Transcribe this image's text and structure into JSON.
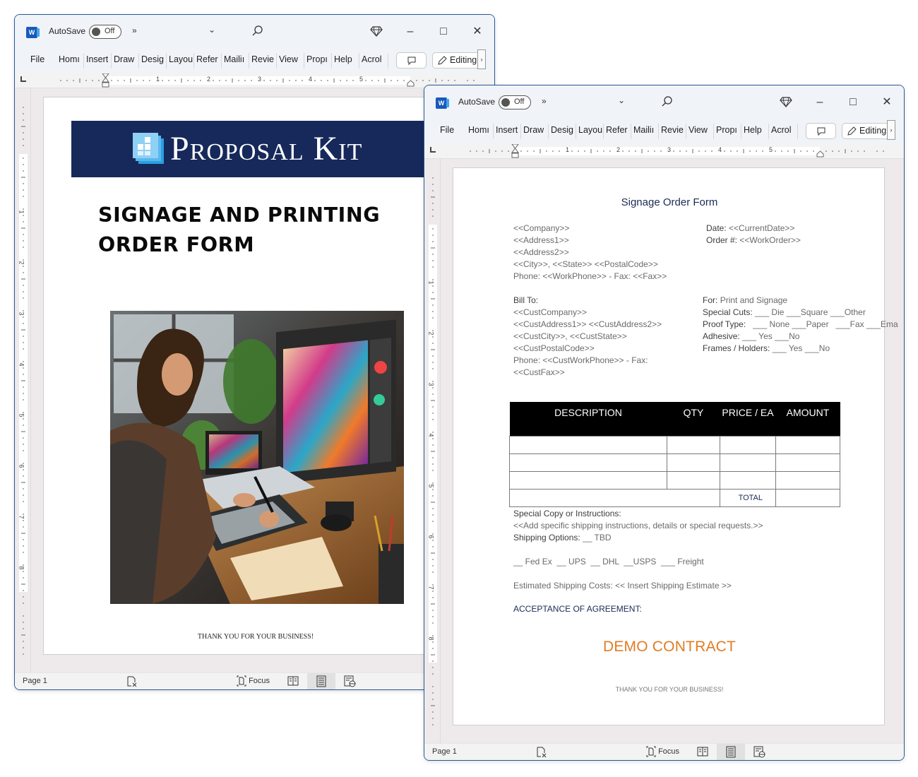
{
  "windows": [
    {
      "id": "win1",
      "app_icon": "word-icon",
      "autosave_label": "AutoSave",
      "autosave_state": "Off",
      "more_commands": "»",
      "ribbon_tabs": [
        "File",
        "Home",
        "Insert",
        "Draw",
        "Design",
        "Layout",
        "References",
        "Mailings",
        "Review",
        "View",
        "Properties",
        "Help",
        "Acrobat"
      ],
      "ribbon_tabs_visible": [
        "File",
        "Homı",
        "Insert",
        "Draw",
        "Desig",
        "Layou",
        "Refer",
        "Mailiı",
        "Revie",
        "View",
        "Propı",
        "Help",
        "Acrol"
      ],
      "editing_label": "Editing",
      "ruler_numbers": [
        "1",
        "2",
        "3",
        "4",
        "5"
      ],
      "vruler_numbers": [
        "1",
        "2",
        "3",
        "4",
        "5",
        "6",
        "7",
        "8"
      ],
      "status": {
        "page": "Page 1",
        "focus_label": "Focus"
      },
      "document": {
        "brand_name": "Proposal Kit",
        "brand_colors": {
          "banner": "#16295a",
          "logo_light": "#8fd0f5",
          "logo_accent": "#2a9fe0"
        },
        "title_line1": "SIGNAGE AND PRINTING",
        "title_line2": "ORDER FORM",
        "image_description": "Woman drawing on a pen tablet at a desk in front of a monitor showing colorful digital artwork",
        "footer": "THANK YOU FOR YOUR BUSINESS!"
      }
    },
    {
      "id": "win2",
      "app_icon": "word-icon",
      "autosave_label": "AutoSave",
      "autosave_state": "Off",
      "more_commands": "»",
      "ribbon_tabs_visible": [
        "File",
        "Homı",
        "Insert",
        "Draw",
        "Desig",
        "Layou",
        "Refer",
        "Mailiı",
        "Revie",
        "View",
        "Propı",
        "Help",
        "Acrol"
      ],
      "editing_label": "Editing",
      "ruler_numbers": [
        "1",
        "2",
        "3",
        "4",
        "5"
      ],
      "vruler_numbers": [
        "1",
        "2",
        "3",
        "4",
        "5",
        "6",
        "7",
        "8"
      ],
      "status": {
        "page": "Page 1",
        "focus_label": "Focus"
      },
      "document": {
        "title": "Signage Order Form",
        "company_lines": [
          "<<Company>>",
          "<<Address1>>",
          "<<Address2>>",
          "<<City>>, <<State>>  <<PostalCode>>",
          "Phone: <<WorkPhone>>  - Fax: <<Fax>>"
        ],
        "date_label": "Date:",
        "date_value": "<<CurrentDate>>",
        "order_label": "Order #:",
        "order_value": "<<WorkOrder>>",
        "bill_to_label": "Bill To:",
        "bill_to_lines": [
          "<<CustCompany>>",
          "<<CustAddress1>> <<CustAddress2>>",
          "<<CustCity>>, <<CustState>>",
          "<<CustPostalCode>>",
          "Phone: <<CustWorkPhone>>  - Fax:",
          "<<CustFax>>"
        ],
        "for_label": "For:",
        "for_value": "Print and Signage",
        "special_cuts_label": "Special Cuts:",
        "special_cuts_value": "___ Die  ___Square  ___Other",
        "proof_type_label": "Proof Type:",
        "proof_type_value": "  ___ None ___Paper   ___Fax ___Ema",
        "adhesive_label": "Adhesive:",
        "adhesive_value": "___ Yes ___No",
        "frames_label": "Frames / Holders:",
        "frames_value": "___ Yes ___No",
        "table": {
          "headers": [
            "DESCRIPTION",
            "QTY",
            "PRICE / EA",
            "AMOUNT"
          ],
          "rows": [
            [
              "",
              "",
              "",
              ""
            ],
            [
              "",
              "",
              "",
              ""
            ],
            [
              "",
              "",
              "",
              ""
            ]
          ],
          "total_label": "TOTAL",
          "total_value": ""
        },
        "special_copy_label": "Special Copy or Instructions:",
        "special_copy_value": "<<Add specific shipping instructions, details or special requests.>>",
        "shipping_options_label": "Shipping Options:",
        "shipping_options_value": "__ TBD",
        "shipping_carriers": "__ Fed Ex  __ UPS  __ DHL  __USPS  ___ Freight",
        "estimated_shipping": "Estimated Shipping Costs: << Insert Shipping Estimate >>",
        "acceptance_label": "ACCEPTANCE OF AGREEMENT:",
        "watermark": "DEMO CONTRACT",
        "watermark_color": "#e07c24",
        "footer": "THANK YOU FOR YOUR BUSINESS!"
      }
    }
  ]
}
